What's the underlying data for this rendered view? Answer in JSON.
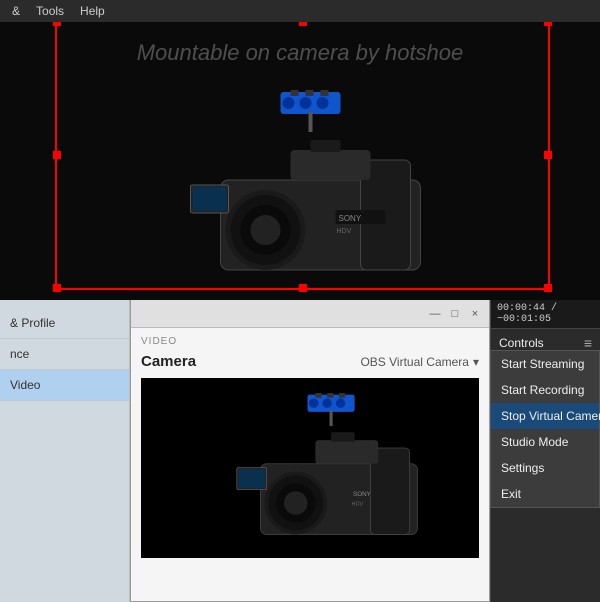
{
  "menubar": {
    "items": [
      "&",
      "Tools",
      "Help"
    ]
  },
  "preview": {
    "watermark": "Mountable on camera by hotshoe"
  },
  "bottom": {
    "sidebar": {
      "items": [
        {
          "label": "& Profile",
          "active": false
        },
        {
          "label": "nce",
          "active": false
        },
        {
          "label": "Video",
          "active": true
        }
      ]
    },
    "window": {
      "title": "",
      "minimize": "—",
      "maximize": "□",
      "close": "×",
      "video_label": "VIDEO",
      "source_name": "Camera",
      "source_dropdown": "OBS Virtual Camera",
      "chevron": "▾"
    },
    "controls": {
      "timer": "00:00:44 / ~00:01:05",
      "title": "Controls",
      "menu_icon": "≡",
      "items": [
        {
          "label": "Start Streaming",
          "active": false
        },
        {
          "label": "Start Recording",
          "active": false
        },
        {
          "label": "Stop Virtual Camera",
          "active": true
        },
        {
          "label": "Studio Mode",
          "active": false
        },
        {
          "label": "Settings",
          "active": false
        },
        {
          "label": "Exit",
          "active": false
        }
      ]
    }
  }
}
